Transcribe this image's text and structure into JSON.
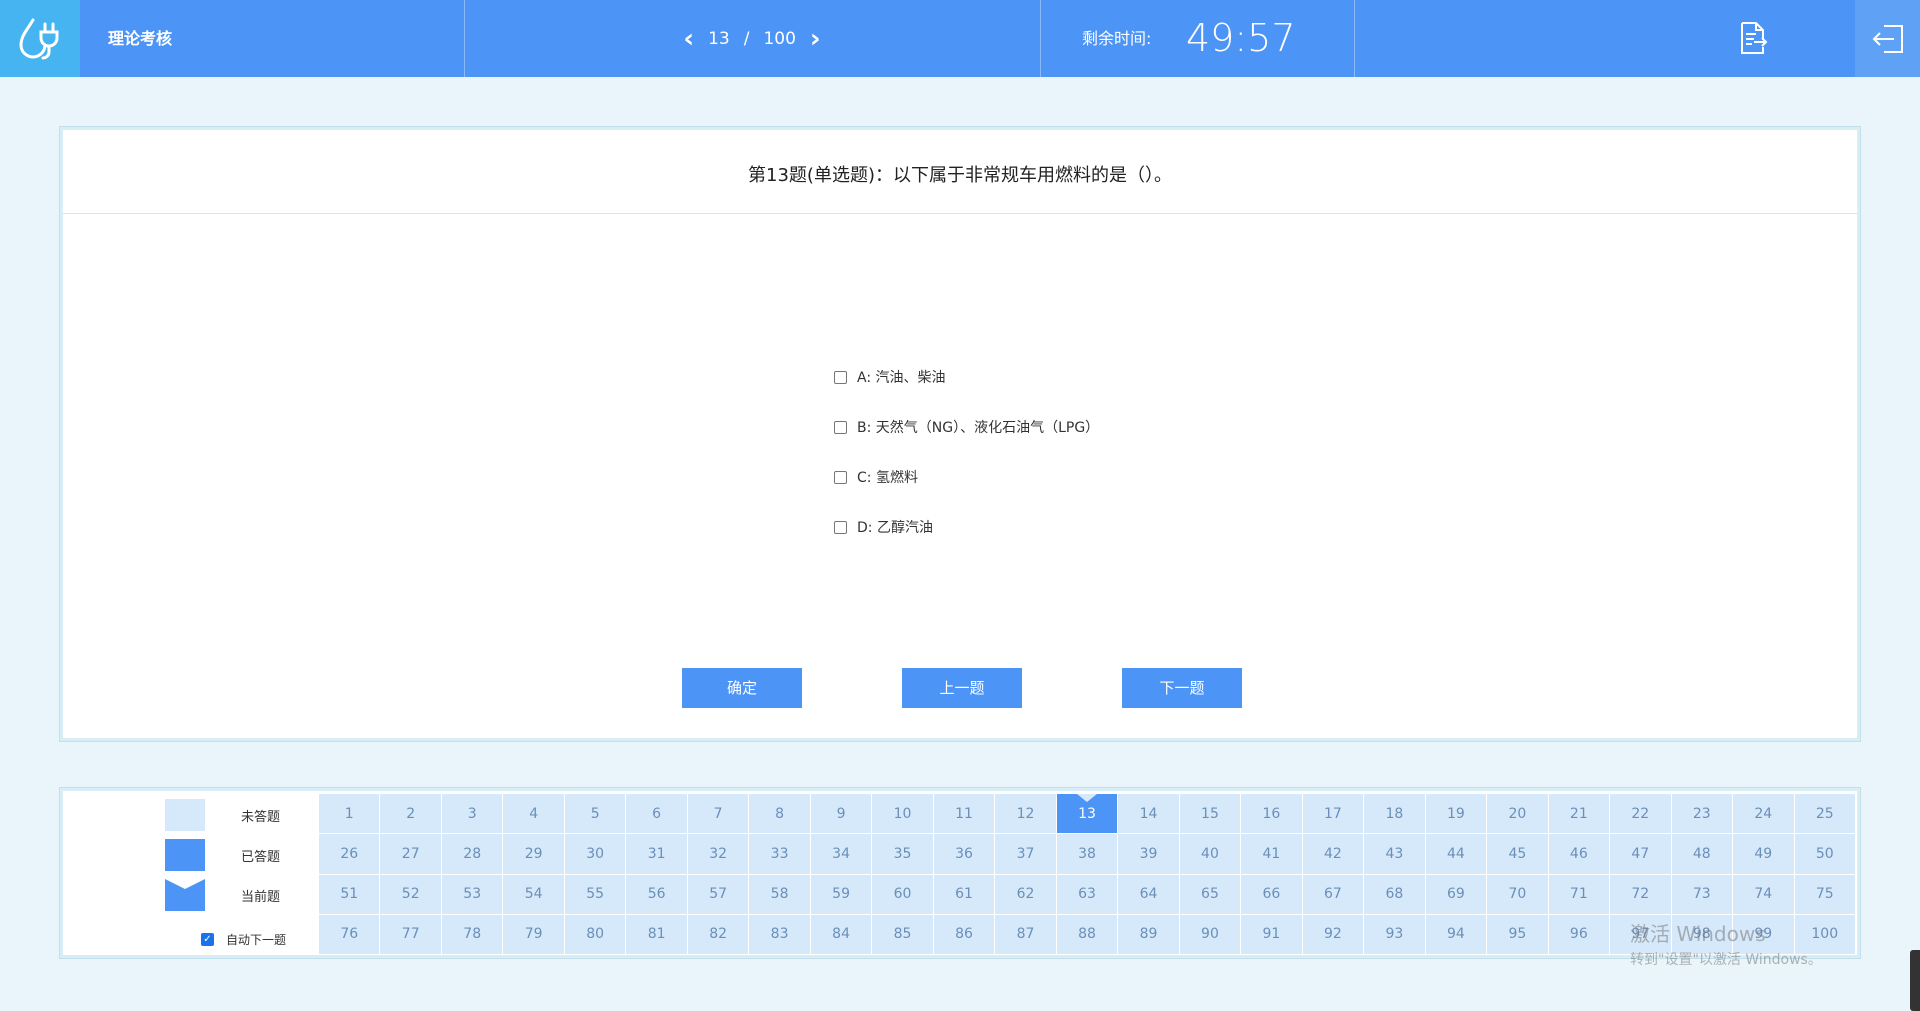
{
  "header": {
    "app_title": "理论考核",
    "current_page": "13",
    "separator": "/",
    "total_pages": "100",
    "timer_label": "剩余时间:",
    "timer_value": "49:57",
    "accent": "#4d94f7"
  },
  "question": {
    "title": "第13题(单选题)：以下属于非常规车用燃料的是（）。",
    "options": [
      {
        "label": "A: 汽油、柴油",
        "checked": false
      },
      {
        "label": "B: 天然气（NG）、液化石油气（LPG）",
        "checked": false
      },
      {
        "label": "C: 氢燃料",
        "checked": false
      },
      {
        "label": "D: 乙醇汽油",
        "checked": false
      }
    ]
  },
  "buttons": {
    "confirm": "确定",
    "prev": "上一题",
    "next": "下一题"
  },
  "legend": {
    "unanswered": "未答题",
    "answered": "已答题",
    "current": "当前题",
    "auto_next": "自动下一题",
    "auto_next_checked": true
  },
  "navigator": {
    "current": 13,
    "numbers": [
      "1",
      "2",
      "3",
      "4",
      "5",
      "6",
      "7",
      "8",
      "9",
      "10",
      "11",
      "12",
      "13",
      "14",
      "15",
      "16",
      "17",
      "18",
      "19",
      "20",
      "21",
      "22",
      "23",
      "24",
      "25",
      "26",
      "27",
      "28",
      "29",
      "30",
      "31",
      "32",
      "33",
      "34",
      "35",
      "36",
      "37",
      "38",
      "39",
      "40",
      "41",
      "42",
      "43",
      "44",
      "45",
      "46",
      "47",
      "48",
      "49",
      "50",
      "51",
      "52",
      "53",
      "54",
      "55",
      "56",
      "57",
      "58",
      "59",
      "60",
      "61",
      "62",
      "63",
      "64",
      "65",
      "66",
      "67",
      "68",
      "69",
      "70",
      "71",
      "72",
      "73",
      "74",
      "75",
      "76",
      "77",
      "78",
      "79",
      "80",
      "81",
      "82",
      "83",
      "84",
      "85",
      "86",
      "87",
      "88",
      "89",
      "90",
      "91",
      "92",
      "93",
      "94",
      "95",
      "96",
      "97",
      "98",
      "99",
      "100"
    ]
  },
  "os_watermark": {
    "line1": "激活 Windows",
    "line2": "转到\"设置\"以激活 Windows。"
  },
  "icons": {
    "logo": "plug-drop-icon",
    "prev": "chevron-left-icon",
    "next": "chevron-right-icon",
    "submit": "submit-paper-icon",
    "exit": "exit-icon"
  }
}
